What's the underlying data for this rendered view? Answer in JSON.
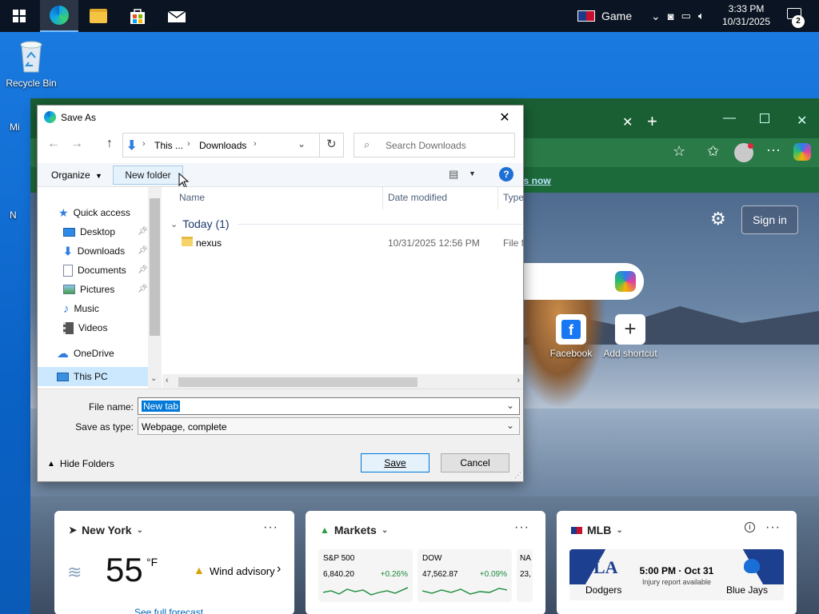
{
  "taskbar": {
    "game_label": "Game",
    "time": "3:33 PM",
    "date": "10/31/2025",
    "notification_count": "2"
  },
  "desktop": {
    "recycle_bin_label": "Recycle Bin"
  },
  "browser": {
    "sign_in_label": "Sign in",
    "banner_link": "es now",
    "shortcuts": [
      {
        "label": "Facebook"
      },
      {
        "label": "Add shortcut"
      }
    ],
    "weather": {
      "location": "New York",
      "temp": "55",
      "unit": "°F",
      "alert": "Wind advisory",
      "footer": "See full forecast"
    },
    "markets": {
      "title": "Markets",
      "tickers": [
        {
          "name": "S&P 500",
          "value": "6,840.20",
          "change": "+0.26%"
        },
        {
          "name": "DOW",
          "value": "47,562.87",
          "change": "+0.09%"
        },
        {
          "name": "NA",
          "value": "23,",
          "change": ""
        }
      ]
    },
    "mlb": {
      "title": "MLB",
      "time": "5:00 PM · Oct 31",
      "note": "Injury report available",
      "team_left": "Dodgers",
      "team_right": "Blue Jays"
    }
  },
  "dialog": {
    "title": "Save As",
    "breadcrumb": [
      "This ...",
      "Downloads"
    ],
    "search_placeholder": "Search Downloads",
    "organize_label": "Organize",
    "new_folder_label": "New folder",
    "nav_items": [
      {
        "label": "Quick access",
        "icon": "star-icon"
      },
      {
        "label": "Desktop",
        "icon": "desktop-icon",
        "pinned": true
      },
      {
        "label": "Downloads",
        "icon": "download-icon",
        "pinned": true
      },
      {
        "label": "Documents",
        "icon": "documents-icon",
        "pinned": true
      },
      {
        "label": "Pictures",
        "icon": "pictures-icon",
        "pinned": true
      },
      {
        "label": "Music",
        "icon": "music-icon"
      },
      {
        "label": "Videos",
        "icon": "videos-icon"
      },
      {
        "label": "OneDrive",
        "icon": "cloud-icon"
      },
      {
        "label": "This PC",
        "icon": "computer-icon"
      }
    ],
    "columns": [
      "Name",
      "Date modified",
      "Type"
    ],
    "group_label": "Today (1)",
    "files": [
      {
        "name": "nexus",
        "date": "10/31/2025 12:56 PM",
        "type": "File fo"
      }
    ],
    "file_name_label": "File name:",
    "file_name_value": "New tab",
    "save_type_label": "Save as type:",
    "save_type_value": "Webpage, complete",
    "hide_folders_label": "Hide Folders",
    "save_label": "Save",
    "cancel_label": "Cancel"
  }
}
